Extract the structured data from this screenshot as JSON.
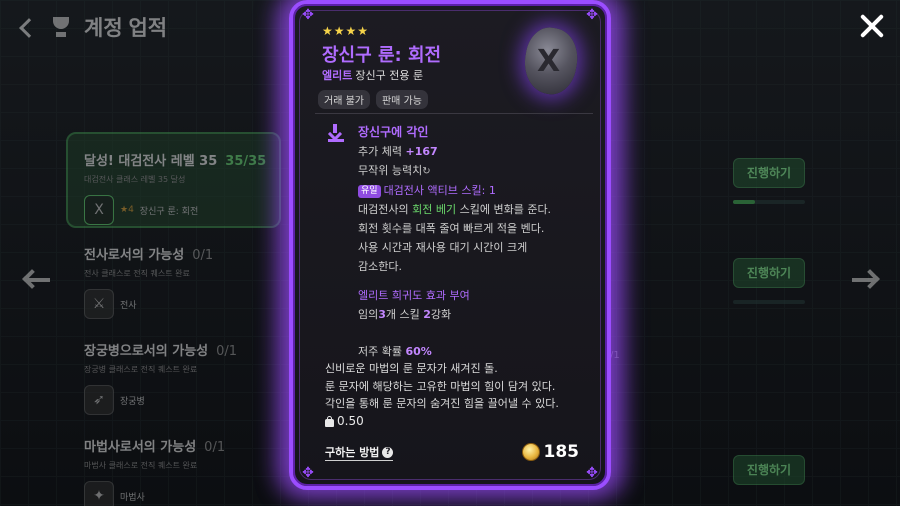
{
  "screen": {
    "title": "계정 업적"
  },
  "achievements": [
    {
      "title": "달성! 대검전사 레벨 35",
      "progress": "35/35",
      "desc": "대검전사 클래스 레벨 35 달성",
      "reward_stars": "★4",
      "reward_label": "장신구 룬: 회전",
      "active": true
    },
    {
      "title": "전사로서의 가능성",
      "progress": "0/1",
      "desc": "전사 클래스로 전직 퀘스트 완료",
      "reward_label": "전사"
    },
    {
      "title": "장궁병으로서의 가능성",
      "progress": "0/1",
      "desc": "장궁병 클래스로 전직 퀘스트 완료",
      "reward_label": "장궁병"
    },
    {
      "title": "마법사로서의 가능성",
      "progress": "0/1",
      "desc": "마법사 클래스로 전직 퀘스트 완료",
      "reward_label": "마법사"
    }
  ],
  "progress_buttons": [
    {
      "label": "진행하기",
      "progress": 0.3
    },
    {
      "label": "진행하기",
      "progress": 0
    },
    {
      "label": "진행하기",
      "progress": 0
    }
  ],
  "side_frac": "/1",
  "item": {
    "stars": "★★★★",
    "name": "장신구 룬: 회전",
    "grade": "엘리트",
    "type": "장신구 전용 룬",
    "tags": [
      "거래 불가",
      "판매 가능"
    ],
    "rune_glyph": "X",
    "engrave_title": "장신구에 각인",
    "stat_label": "추가 체력",
    "stat_value": "+167",
    "random_label": "무작위 능력치",
    "unique_badge": "유일",
    "skill_label": "대검전사 액티브 스킬",
    "skill_value": ": 1",
    "desc_1a": "대검전사의",
    "desc_1b": "회전",
    "desc_1c": "베기",
    "desc_1d": "스킬에 변화를 준다.",
    "desc_2": "회전 횟수를 대폭 줄여 빠르게 적을 벤다.",
    "desc_3": "사용 시간과 재사용 대기 시간이 크게",
    "desc_4": "감소한다.",
    "elite_effect": "엘리트 희귀도 효과 부여",
    "elite_a": "임의",
    "elite_b": "3",
    "elite_c": "개 스킬",
    "elite_d": "2",
    "elite_e": "강화",
    "curse_label": "저주 확률",
    "curse_value": "60%",
    "lore_1": "신비로운 마법의 룬 문자가 새겨진 돌.",
    "lore_2": "룬 문자에 해당하는 고유한 마법의 힘이 담겨 있다.",
    "lore_3": "각인을 통해 룬 문자의 숨겨진 힘을 끌어낼 수 있다.",
    "weight": "0.50",
    "howto": "구하는 방법",
    "price": "185",
    "accent": "#9b4dff"
  }
}
